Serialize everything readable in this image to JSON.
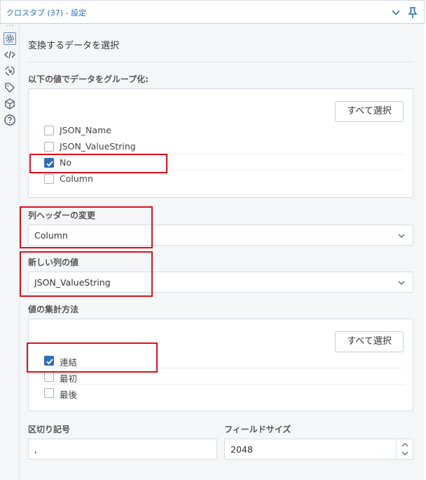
{
  "window": {
    "title": "クロスタブ (37) - 設定"
  },
  "main": {
    "heading": "変換するデータを選択"
  },
  "group_by": {
    "label": "以下の値でデータをグループ化:",
    "select_all": "すべて選択",
    "fields": [
      {
        "label": "JSON_Name",
        "checked": false
      },
      {
        "label": "JSON_ValueString",
        "checked": false
      },
      {
        "label": "No",
        "checked": true
      },
      {
        "label": "Column",
        "checked": false
      }
    ]
  },
  "header_change": {
    "label": "列ヘッダーの変更",
    "value": "Column"
  },
  "new_column_value": {
    "label": "新しい列の値",
    "value": "JSON_ValueString"
  },
  "aggregation": {
    "label": "値の集計方法",
    "select_all": "すべて選択",
    "methods": [
      {
        "label": "連結",
        "checked": true
      },
      {
        "label": "最初",
        "checked": false
      },
      {
        "label": "最後",
        "checked": false
      }
    ]
  },
  "delimiter": {
    "label": "区切り記号",
    "value": ","
  },
  "field_size": {
    "label": "フィールドサイズ",
    "value": "2048"
  },
  "sidebar": {
    "icons": [
      "gear-icon",
      "code-icon",
      "workflow-icon",
      "tag-icon",
      "cube-icon",
      "help-icon"
    ]
  },
  "colors": {
    "accent": "#2f6db5",
    "highlight": "#e0101a",
    "title": "#2a6fb6"
  }
}
